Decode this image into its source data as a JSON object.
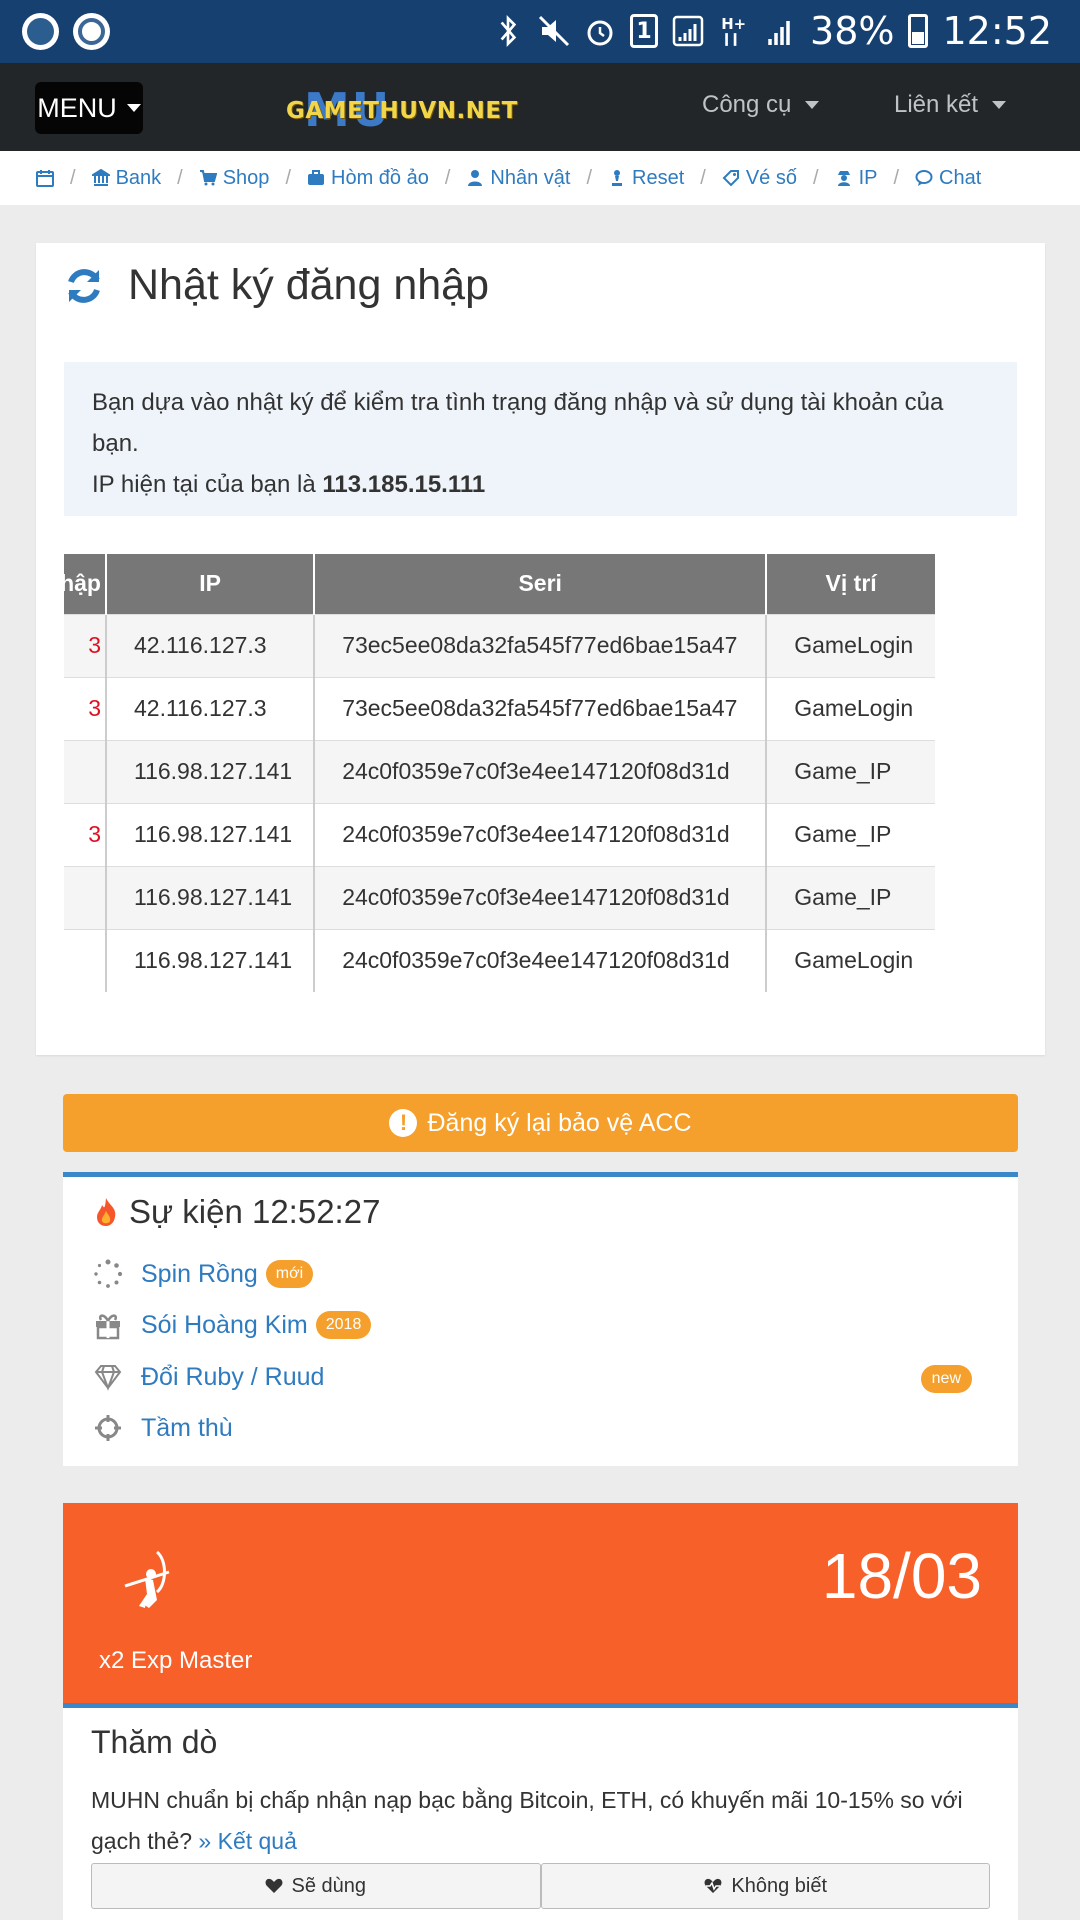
{
  "status_bar": {
    "battery": "38%",
    "time": "12:52",
    "sim_label": "1"
  },
  "navbar": {
    "menu_label": "MENU",
    "logo_text": "GAMETHUVN.NET",
    "logo_bg": "MU",
    "tools_label": "Công cụ",
    "links_label": "Liên kết"
  },
  "breadcrumbs": [
    {
      "label": "",
      "icon": "calendar-icon"
    },
    {
      "label": "Bank",
      "icon": "bank-icon"
    },
    {
      "label": "Shop",
      "icon": "cart-icon"
    },
    {
      "label": "Hòm đồ ảo",
      "icon": "briefcase-icon"
    },
    {
      "label": "Nhân vật",
      "icon": "user-icon"
    },
    {
      "label": "Reset",
      "icon": "reset-icon"
    },
    {
      "label": "Vé số",
      "icon": "ticket-icon"
    },
    {
      "label": "IP",
      "icon": "user-secret-icon"
    },
    {
      "label": "Chat",
      "icon": "chat-icon"
    }
  ],
  "login_log": {
    "title": "Nhật ký đăng nhập",
    "info_line1": "Bạn dựa vào nhật ký để kiểm tra tình trạng đăng nhập và sử dụng tài khoản của bạn.",
    "info_ip_prefix": "IP hiện tại của bạn là ",
    "info_ip": "113.185.15.111",
    "columns": [
      "nhập",
      "IP",
      "Seri",
      "Vị trí"
    ],
    "rows": [
      {
        "login": "3",
        "ip": "42.116.127.3",
        "seri": "73ec5ee08da32fa545f77ed6bae15a47",
        "location": "GameLogin"
      },
      {
        "login": "3",
        "ip": "42.116.127.3",
        "seri": "73ec5ee08da32fa545f77ed6bae15a47",
        "location": "GameLogin"
      },
      {
        "login": "",
        "ip": "116.98.127.141",
        "seri": "24c0f0359e7c0f3e4ee147120f08d31d",
        "location": "Game_IP"
      },
      {
        "login": "3",
        "ip": "116.98.127.141",
        "seri": "24c0f0359e7c0f3e4ee147120f08d31d",
        "location": "Game_IP"
      },
      {
        "login": "",
        "ip": "116.98.127.141",
        "seri": "24c0f0359e7c0f3e4ee147120f08d31d",
        "location": "Game_IP"
      },
      {
        "login": "",
        "ip": "116.98.127.141",
        "seri": "24c0f0359e7c0f3e4ee147120f08d31d",
        "location": "GameLogin"
      }
    ]
  },
  "warn_button": {
    "label": "Đăng ký lại bảo vệ ACC",
    "icon": "exclamation-icon"
  },
  "events": {
    "title": "Sự kiện 12:52:27",
    "items": [
      {
        "label": "Spin Rồng",
        "badge": "mới",
        "icon": "spinner-icon"
      },
      {
        "label": "Sói Hoàng Kim",
        "badge": "2018",
        "icon": "gift-icon"
      },
      {
        "label": "Đổi Ruby / Ruud",
        "badge": "",
        "icon": "diamond-icon"
      },
      {
        "label": "Tầm thù",
        "badge": "",
        "icon": "crosshairs-icon"
      }
    ],
    "right_badge": "new"
  },
  "promo": {
    "date": "18/03",
    "subtitle": "x2 Exp Master",
    "icon": "archer-icon",
    "color": "#f8602a"
  },
  "poll": {
    "title": "Thăm dò",
    "text": "MUHN chuẩn bị chấp nhận nạp bạc bằng Bitcoin, ETH, có khuyến mãi 10-15% so với gạch thẻ?",
    "result_link": "» Kết quả",
    "option1": "Sẽ dùng",
    "option2": "Không biết"
  },
  "colors": {
    "status_bar": "#16406f",
    "navbar": "#222629",
    "link": "#2f7bbf",
    "warn": "#f5a02c",
    "accent_border": "#3a87c9"
  }
}
